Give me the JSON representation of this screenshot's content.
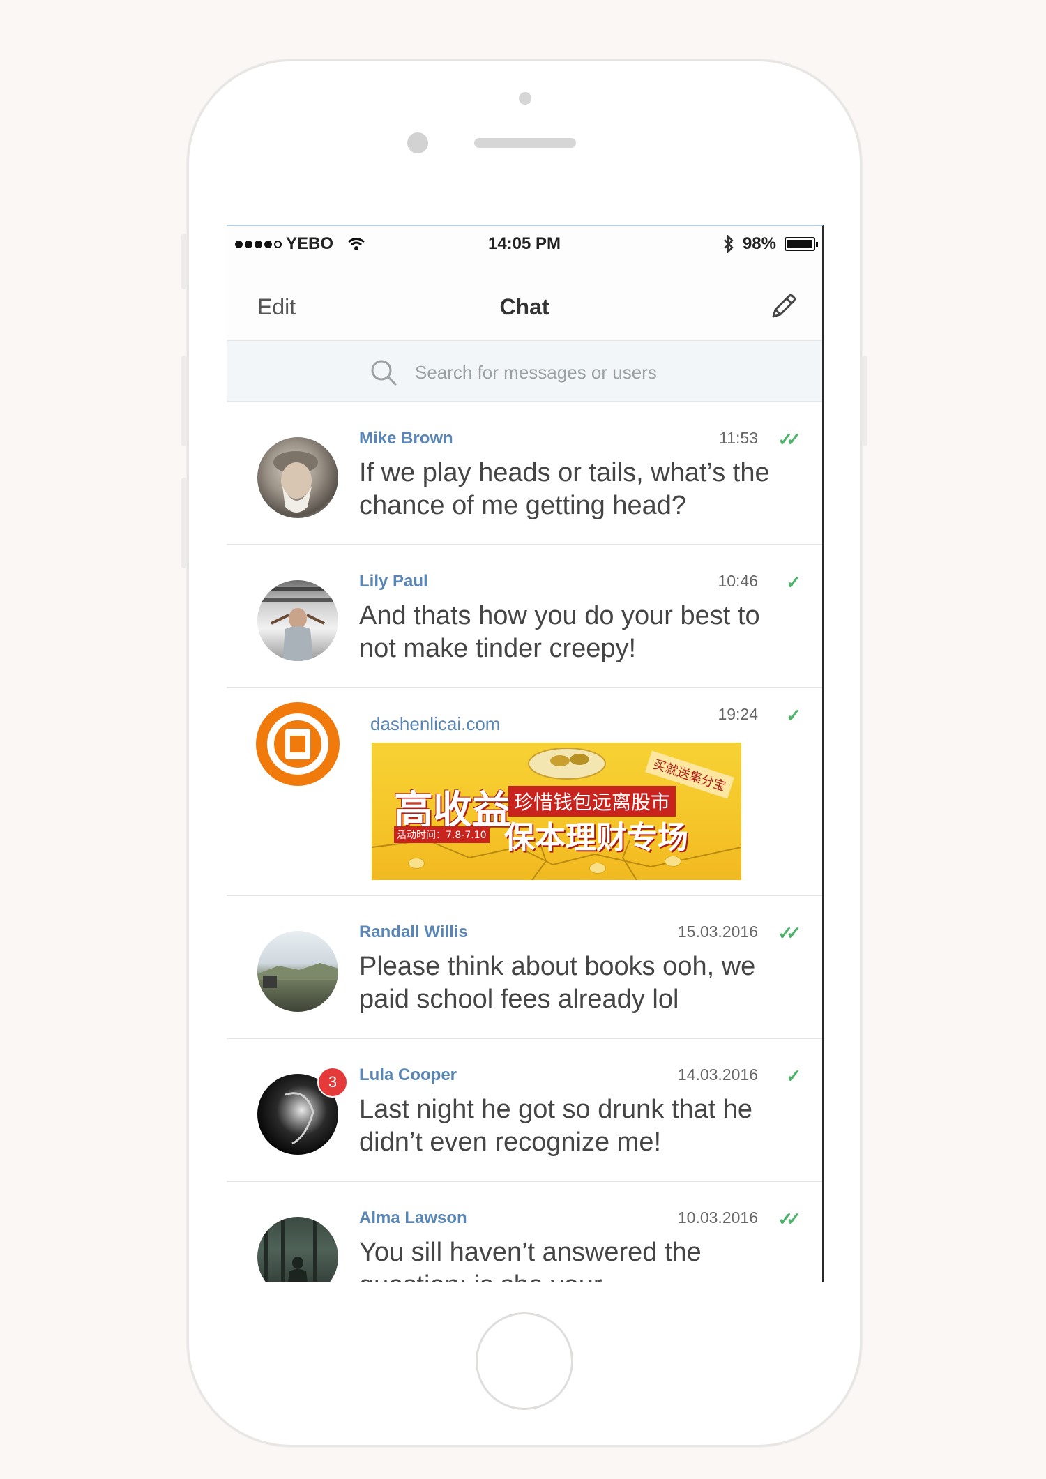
{
  "status_bar": {
    "carrier": "YEBO",
    "time": "14:05 PM",
    "battery": "98%",
    "battery_level": 0.98
  },
  "nav": {
    "edit_label": "Edit",
    "title": "Chat",
    "compose_icon": "pencil-icon"
  },
  "search": {
    "placeholder": "Search for messages or users",
    "icon": "search-icon"
  },
  "chats": [
    {
      "name": "Mike Brown",
      "time": "11:53",
      "read": "double-check",
      "message": "If we play heads or tails, what’s the chance of me getting head?"
    },
    {
      "name": "Lily Paul",
      "time": "10:46",
      "read": "single-check",
      "message": "And thats how you do your best to not make tinder creepy!"
    },
    {
      "name": "Randall Willis",
      "time": "15.03.2016",
      "read": "double-check",
      "message": "Please think about books ooh, we paid school fees already lol"
    },
    {
      "name": "Lula Cooper",
      "time": "14.03.2016",
      "read": "single-check",
      "unread": "3",
      "message": "Last night he got so drunk that he didn’t even recognize me!"
    },
    {
      "name": "Alma Lawson",
      "time": "10.03.2016",
      "read": "double-check",
      "message": "You sill haven’t answered the question: is she your..."
    }
  ],
  "ad": {
    "domain": "dashenlicai.com",
    "time": "19:24",
    "read": "single-check",
    "headline_big": "高收益",
    "headline_top": "珍惜钱包远离股市",
    "headline_main": "保本理财专场",
    "date_text": "活动时间：7.8-7.10",
    "corner_tag": "买就送集分宝"
  },
  "colors": {
    "accent_blue": "#5a86b5",
    "check_green": "#4db36a",
    "badge_red": "#e53a3a",
    "ad_orange": "#f07a0c"
  }
}
